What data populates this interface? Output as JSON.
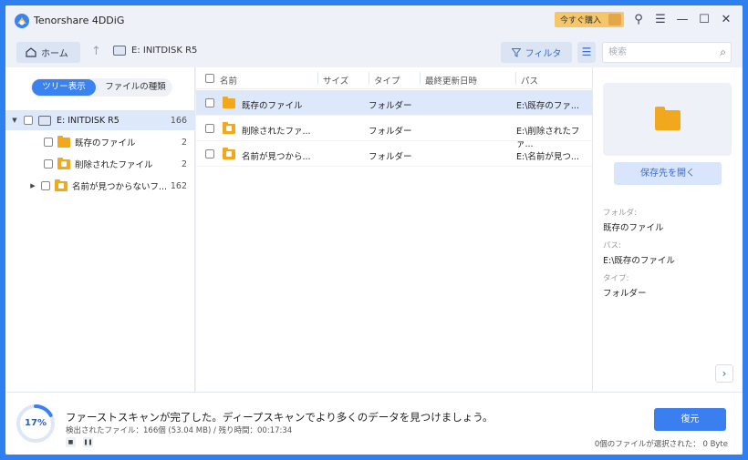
{
  "window": {
    "title": "Tenorshare 4DDiG",
    "buy_label": "今すぐ購入"
  },
  "toolbar": {
    "home_label": "ホーム",
    "current_drive": "E: INITDISK R5",
    "filter_label": "フィルタ",
    "search_placeholder": "検索"
  },
  "left_panel": {
    "tabs": [
      "ツリー表示",
      "ファイルの種類"
    ],
    "active_tab": "ツリー表示",
    "tree": {
      "root": {
        "label": "E: INITDISK R5",
        "count": "166"
      },
      "children": [
        {
          "label": "既存のファイル",
          "count": "2",
          "expandable": false
        },
        {
          "label": "削除されたファイル",
          "count": "2",
          "expandable": false
        },
        {
          "label": "名前が見つからないフ...",
          "count": "162",
          "expandable": true
        }
      ]
    }
  },
  "file_list": {
    "columns": [
      "名前",
      "サイズ",
      "タイプ",
      "最終更新日時",
      "パス"
    ],
    "rows": [
      {
        "name": "既存のファイル",
        "size": "",
        "type": "フォルダー",
        "modified": "",
        "path": "E:\\既存のファ...",
        "selected": true
      },
      {
        "name": "削除されたファ...",
        "size": "",
        "type": "フォルダー",
        "modified": "",
        "path": "E:\\削除されたファ...",
        "selected": false
      },
      {
        "name": "名前が見つから...",
        "size": "",
        "type": "フォルダー",
        "modified": "",
        "path": "E:\\名前が見つ...",
        "selected": false
      }
    ]
  },
  "preview": {
    "open_button": "保存先を開く",
    "folder_label": "フォルダ:",
    "folder_value": "既存のファイル",
    "path_label": "パス:",
    "path_value": "E:\\既存のファイル",
    "type_label": "タイプ:",
    "type_value": "フォルダー"
  },
  "status": {
    "progress_percent": 17,
    "progress_label": "17%",
    "message": "ファーストスキャンが完了した。ディープスキャンでより多くのデータを見つけましょう。",
    "details": "検出されたファイル：166個 (53.04 MB) /  残り時間：00:17:34",
    "restore_label": "復元",
    "selection_info": "0個のファイルが選択された：  0 Byte"
  },
  "colors": {
    "accent": "#3a7ef0",
    "folder": "#f2a81d",
    "selected_row": "#dde8fb",
    "buy_badge": "#f5c76a"
  }
}
